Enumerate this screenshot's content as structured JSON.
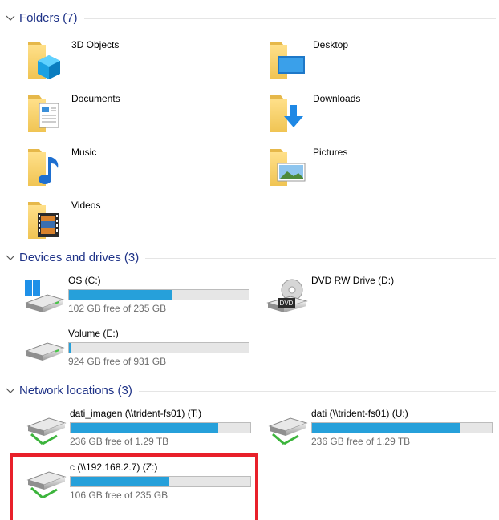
{
  "groups": {
    "folders": {
      "title": "Folders (7)"
    },
    "devices": {
      "title": "Devices and drives (3)"
    },
    "network": {
      "title": "Network locations (3)"
    }
  },
  "folders": [
    {
      "name": "3D Objects",
      "icon": "3d-objects-folder-icon"
    },
    {
      "name": "Desktop",
      "icon": "desktop-folder-icon"
    },
    {
      "name": "Documents",
      "icon": "documents-folder-icon"
    },
    {
      "name": "Downloads",
      "icon": "downloads-folder-icon"
    },
    {
      "name": "Music",
      "icon": "music-folder-icon"
    },
    {
      "name": "Pictures",
      "icon": "pictures-folder-icon"
    },
    {
      "name": "Videos",
      "icon": "videos-folder-icon"
    }
  ],
  "devices": [
    {
      "name": "OS (C:)",
      "free": "102 GB free of 235 GB",
      "used_fraction": 0.57,
      "icon": "windows-drive-icon"
    },
    {
      "name": "DVD RW Drive (D:)",
      "icon": "dvd-drive-icon"
    },
    {
      "name": "Volume (E:)",
      "free": "924 GB free of 931 GB",
      "used_fraction": 0.01,
      "icon": "hard-drive-icon"
    }
  ],
  "network": [
    {
      "name": "dati_imagen (\\\\trident-fs01) (T:)",
      "free": "236 GB free of 1.29 TB",
      "used_fraction": 0.82,
      "icon": "network-drive-icon"
    },
    {
      "name": "dati (\\\\trident-fs01) (U:)",
      "free": "236 GB free of 1.29 TB",
      "used_fraction": 0.82,
      "icon": "network-drive-icon"
    },
    {
      "name": "c (\\\\192.168.2.7) (Z:)",
      "free": "106 GB free of 235 GB",
      "used_fraction": 0.55,
      "icon": "network-drive-icon"
    }
  ],
  "colors": {
    "accent_bar": "#26a0da",
    "group_title": "#1e3287",
    "highlight": "#e8202a",
    "folder": "#f8d775"
  }
}
